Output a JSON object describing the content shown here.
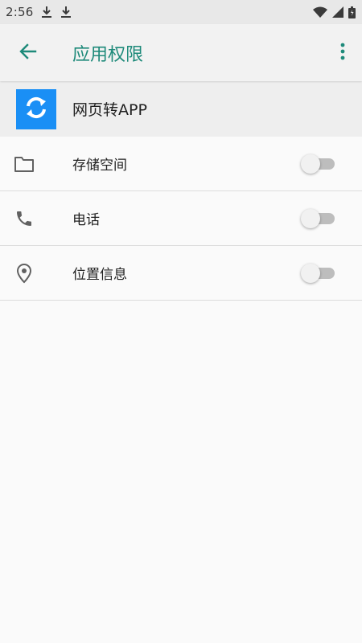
{
  "status_bar": {
    "time": "2:56",
    "icons": [
      "download-icon",
      "download-icon",
      "wifi-icon",
      "signal-icon",
      "battery-icon"
    ]
  },
  "toolbar": {
    "title": "应用权限",
    "back_icon": "arrow-back-icon",
    "menu_icon": "more-vert-icon",
    "accent_color": "#1e8a7a"
  },
  "app": {
    "name": "网页转APP",
    "icon": "sync-icon",
    "icon_bg": "#1a8ff5"
  },
  "permissions": [
    {
      "label": "存储空间",
      "icon": "folder-icon",
      "enabled": false
    },
    {
      "label": "电话",
      "icon": "phone-icon",
      "enabled": false
    },
    {
      "label": "位置信息",
      "icon": "location-pin-icon",
      "enabled": false
    }
  ]
}
